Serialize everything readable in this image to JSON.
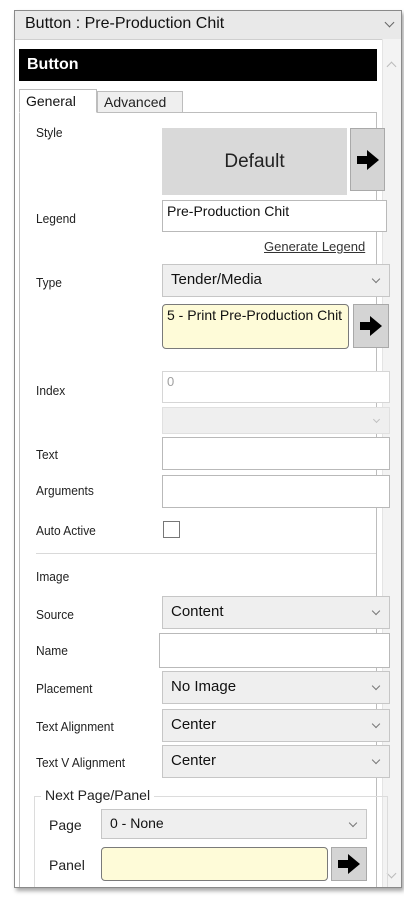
{
  "header": {
    "title": "Button : Pre-Production Chit"
  },
  "panel": {
    "heading": "Button"
  },
  "tabs": [
    {
      "label": "General",
      "active": true
    },
    {
      "label": "Advanced",
      "active": false
    }
  ],
  "general": {
    "style": {
      "label": "Style",
      "value": "Default"
    },
    "legend": {
      "label": "Legend",
      "value": "Pre-Production Chit",
      "generate_link": "Generate Legend"
    },
    "type": {
      "label": "Type",
      "value": "Tender/Media",
      "action": "5 - Print Pre-Production Chit"
    },
    "index": {
      "label": "Index",
      "value": "0",
      "sub_value": ""
    },
    "text": {
      "label": "Text",
      "value": ""
    },
    "arguments": {
      "label": "Arguments",
      "value": ""
    },
    "auto_active": {
      "label": "Auto Active",
      "checked": false
    }
  },
  "image": {
    "heading": "Image",
    "source": {
      "label": "Source",
      "value": "Content"
    },
    "name": {
      "label": "Name",
      "value": ""
    },
    "placement": {
      "label": "Placement",
      "value": "No Image"
    },
    "text_alignment": {
      "label": "Text Alignment",
      "value": "Center"
    },
    "text_v_alignment": {
      "label": "Text V Alignment",
      "value": "Center"
    }
  },
  "next_page_panel": {
    "heading": "Next Page/Panel",
    "page": {
      "label": "Page",
      "value": "0 - None"
    },
    "panel": {
      "label": "Panel",
      "value": ""
    }
  },
  "colors": {
    "highlight_yellow": "#fefbd8",
    "header_black": "#000000",
    "tile_gray": "#d9d9d9"
  }
}
